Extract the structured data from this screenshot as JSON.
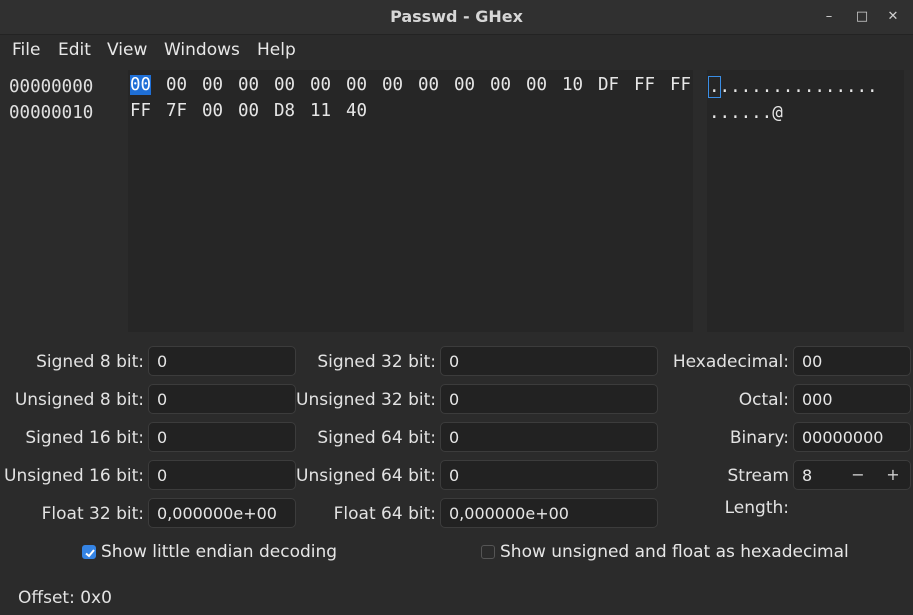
{
  "window": {
    "title": "Passwd - GHex",
    "minimize_glyph": "–",
    "maximize_glyph": "□",
    "close_glyph": "✕"
  },
  "menu": [
    "File",
    "Edit",
    "View",
    "Windows",
    "Help"
  ],
  "hex_view": {
    "offsets": [
      "00000000",
      "00000010"
    ],
    "rows": [
      [
        "00",
        "00",
        "00",
        "00",
        "00",
        "00",
        "00",
        "00",
        "00",
        "00",
        "00",
        "00",
        "10",
        "DF",
        "FF",
        "FF"
      ],
      [
        "FF",
        "7F",
        "00",
        "00",
        "D8",
        "11",
        "40"
      ]
    ],
    "ascii_rows": [
      "................",
      "......@"
    ],
    "cursor_index": 0
  },
  "converter": {
    "col1": [
      {
        "label": "Signed 8 bit:",
        "value": "0"
      },
      {
        "label": "Unsigned 8 bit:",
        "value": "0"
      },
      {
        "label": "Signed 16 bit:",
        "value": "0"
      },
      {
        "label": "Unsigned 16 bit:",
        "value": "0"
      },
      {
        "label": "Float 32 bit:",
        "value": "0,000000e+00"
      }
    ],
    "col2": [
      {
        "label": "Signed 32 bit:",
        "value": "0"
      },
      {
        "label": "Unsigned 32 bit:",
        "value": "0"
      },
      {
        "label": "Signed 64 bit:",
        "value": "0"
      },
      {
        "label": "Unsigned 64 bit:",
        "value": "0"
      },
      {
        "label": "Float 64 bit:",
        "value": "0,000000e+00"
      }
    ],
    "col3": [
      {
        "label": "Hexadecimal:",
        "value": "00"
      },
      {
        "label": "Octal:",
        "value": "000"
      },
      {
        "label": "Binary:",
        "value": "00000000"
      },
      {
        "label": "Stream Length:",
        "value": "8"
      }
    ],
    "stream_minus": "−",
    "stream_plus": "+",
    "little_endian": {
      "label": "Show little endian decoding",
      "checked": true
    },
    "unsigned_hex": {
      "label": "Show unsigned and float as hexadecimal",
      "checked": false
    }
  },
  "status": {
    "offset_text": "Offset: 0x0"
  },
  "colors": {
    "accent": "#3584e4",
    "background": "#2b2b2b",
    "pane": "#262626"
  }
}
